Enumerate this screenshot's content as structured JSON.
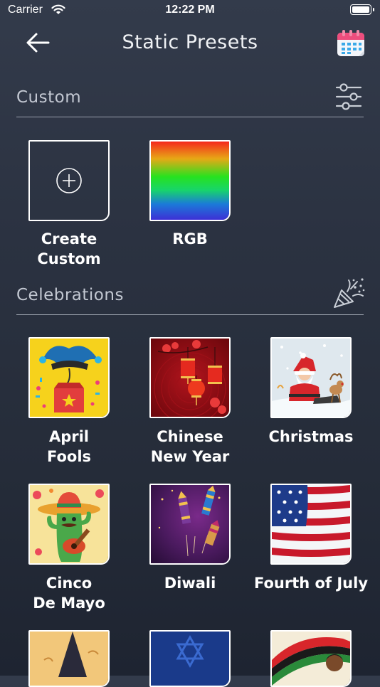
{
  "status_bar": {
    "carrier": "Carrier",
    "time": "12:22 PM"
  },
  "header": {
    "title": "Static Presets",
    "back_icon": "arrow-left-icon",
    "calendar_icon": "calendar-icon"
  },
  "custom": {
    "title": "Custom",
    "filter_icon": "sliders-icon",
    "items": [
      {
        "line1": "Create",
        "line2": "Custom",
        "icon": "plus-circle-icon"
      },
      {
        "label": "RGB"
      }
    ]
  },
  "celebrations": {
    "title": "Celebrations",
    "icon": "party-popper-icon",
    "items": [
      {
        "line1": "April",
        "line2": "Fools"
      },
      {
        "line1": "Chinese",
        "line2": "New Year"
      },
      {
        "label": "Christmas"
      },
      {
        "line1": "Cinco",
        "line2": "De Mayo"
      },
      {
        "label": "Diwali"
      },
      {
        "label": "Fourth of July"
      }
    ]
  },
  "colors": {
    "background": "#2b3241",
    "divider": "#9aa1ad",
    "text": "#ffffff",
    "section_text": "#c3c8d2"
  }
}
